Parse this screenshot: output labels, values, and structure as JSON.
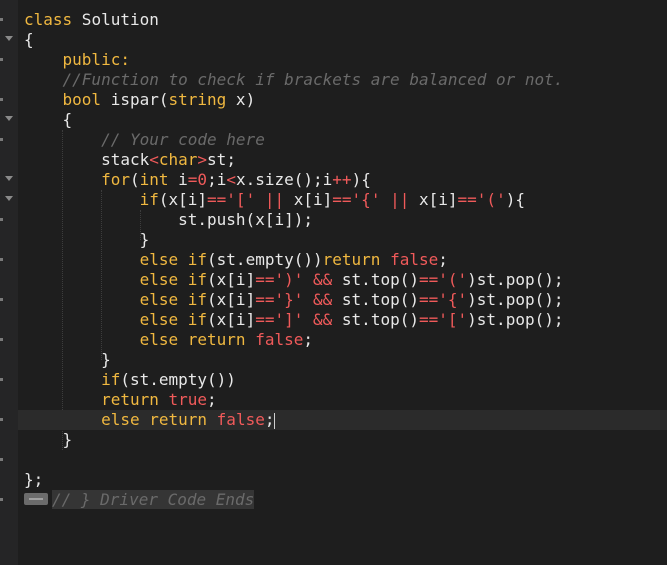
{
  "editor": {
    "lines": [
      {
        "parts": [
          [
            "ty",
            "class"
          ],
          [
            "fn",
            " Solution"
          ]
        ]
      },
      {
        "parts": [
          [
            "fn",
            "{"
          ]
        ]
      },
      {
        "parts": [
          [
            "fn",
            "    "
          ],
          [
            "ty",
            "public:"
          ]
        ]
      },
      {
        "parts": [
          [
            "fn",
            "    "
          ],
          [
            "cm",
            "//Function to check if brackets are balanced or not."
          ]
        ]
      },
      {
        "parts": [
          [
            "fn",
            "    "
          ],
          [
            "ty",
            "bool"
          ],
          [
            "fn",
            " ispar("
          ],
          [
            "ty",
            "string"
          ],
          [
            "fn",
            " x)"
          ]
        ]
      },
      {
        "parts": [
          [
            "fn",
            "    {"
          ]
        ]
      },
      {
        "parts": [
          [
            "fn",
            "        "
          ],
          [
            "cm",
            "// Your code here"
          ]
        ]
      },
      {
        "parts": [
          [
            "fn",
            "        stack"
          ],
          [
            "kw",
            "<"
          ],
          [
            "ty",
            "char"
          ],
          [
            "kw",
            ">"
          ],
          [
            "fn",
            "st;"
          ]
        ]
      },
      {
        "parts": [
          [
            "fn",
            "        "
          ],
          [
            "ty",
            "for"
          ],
          [
            "fn",
            "("
          ],
          [
            "ty",
            "int"
          ],
          [
            "fn",
            " i"
          ],
          [
            "op",
            "="
          ],
          [
            "num",
            "0"
          ],
          [
            "fn",
            ";i"
          ],
          [
            "op",
            "<"
          ],
          [
            "fn",
            "x.size();i"
          ],
          [
            "op",
            "++"
          ],
          [
            "fn",
            "){"
          ]
        ]
      },
      {
        "parts": [
          [
            "fn",
            "            "
          ],
          [
            "ty",
            "if"
          ],
          [
            "fn",
            "(x[i]"
          ],
          [
            "op",
            "=="
          ],
          [
            "str",
            "'['"
          ],
          [
            "fn",
            " "
          ],
          [
            "op",
            "||"
          ],
          [
            "fn",
            " x[i]"
          ],
          [
            "op",
            "=="
          ],
          [
            "str",
            "'{'"
          ],
          [
            "fn",
            " "
          ],
          [
            "op",
            "||"
          ],
          [
            "fn",
            " x[i]"
          ],
          [
            "op",
            "=="
          ],
          [
            "str",
            "'('"
          ],
          [
            "fn",
            "){"
          ]
        ]
      },
      {
        "parts": [
          [
            "fn",
            "                st.push(x[i]);"
          ]
        ]
      },
      {
        "parts": [
          [
            "fn",
            "            }"
          ]
        ]
      },
      {
        "parts": [
          [
            "fn",
            "            "
          ],
          [
            "ty",
            "else if"
          ],
          [
            "fn",
            "(st.empty())"
          ],
          [
            "ty",
            "return"
          ],
          [
            "fn",
            " "
          ],
          [
            "kw",
            "false"
          ],
          [
            "fn",
            ";"
          ]
        ]
      },
      {
        "parts": [
          [
            "fn",
            "            "
          ],
          [
            "ty",
            "else if"
          ],
          [
            "fn",
            "(x[i]"
          ],
          [
            "op",
            "=="
          ],
          [
            "str",
            "')'"
          ],
          [
            "fn",
            " "
          ],
          [
            "op",
            "&&"
          ],
          [
            "fn",
            " st.top()"
          ],
          [
            "op",
            "=="
          ],
          [
            "str",
            "'('"
          ],
          [
            "fn",
            ")st.pop();"
          ]
        ]
      },
      {
        "parts": [
          [
            "fn",
            "            "
          ],
          [
            "ty",
            "else if"
          ],
          [
            "fn",
            "(x[i]"
          ],
          [
            "op",
            "=="
          ],
          [
            "str",
            "'}'"
          ],
          [
            "fn",
            " "
          ],
          [
            "op",
            "&&"
          ],
          [
            "fn",
            " st.top()"
          ],
          [
            "op",
            "=="
          ],
          [
            "str",
            "'{'"
          ],
          [
            "fn",
            ")st.pop();"
          ]
        ]
      },
      {
        "parts": [
          [
            "fn",
            "            "
          ],
          [
            "ty",
            "else if"
          ],
          [
            "fn",
            "(x[i]"
          ],
          [
            "op",
            "=="
          ],
          [
            "str",
            "']'"
          ],
          [
            "fn",
            " "
          ],
          [
            "op",
            "&&"
          ],
          [
            "fn",
            " st.top()"
          ],
          [
            "op",
            "=="
          ],
          [
            "str",
            "'['"
          ],
          [
            "fn",
            ")st.pop();"
          ]
        ]
      },
      {
        "parts": [
          [
            "fn",
            "            "
          ],
          [
            "ty",
            "else return"
          ],
          [
            "fn",
            " "
          ],
          [
            "kw",
            "false"
          ],
          [
            "fn",
            ";"
          ]
        ]
      },
      {
        "parts": [
          [
            "fn",
            "        }"
          ]
        ]
      },
      {
        "parts": [
          [
            "fn",
            "        "
          ],
          [
            "ty",
            "if"
          ],
          [
            "fn",
            "(st.empty())"
          ]
        ]
      },
      {
        "parts": [
          [
            "fn",
            "        "
          ],
          [
            "ty",
            "return"
          ],
          [
            "fn",
            " "
          ],
          [
            "kw",
            "true"
          ],
          [
            "fn",
            ";"
          ]
        ]
      },
      {
        "parts": [
          [
            "fn",
            "        "
          ],
          [
            "ty",
            "else return"
          ],
          [
            "fn",
            " "
          ],
          [
            "kw",
            "false"
          ],
          [
            "fn",
            ";"
          ]
        ],
        "active": true,
        "caret": true
      },
      {
        "parts": [
          [
            "fn",
            "    }"
          ]
        ]
      },
      {
        "parts": [
          [
            "fn",
            ""
          ]
        ]
      },
      {
        "parts": [
          [
            "fn",
            "};"
          ]
        ]
      },
      {
        "parts": [
          [
            "cm",
            "// } Driver Code Ends"
          ]
        ],
        "folded": true
      }
    ]
  },
  "colors": {
    "background": "#1e1e1e",
    "keyword": "#f05a5a",
    "type": "#f0b840",
    "comment": "#6a6a6a",
    "text": "#e8e8e8"
  }
}
